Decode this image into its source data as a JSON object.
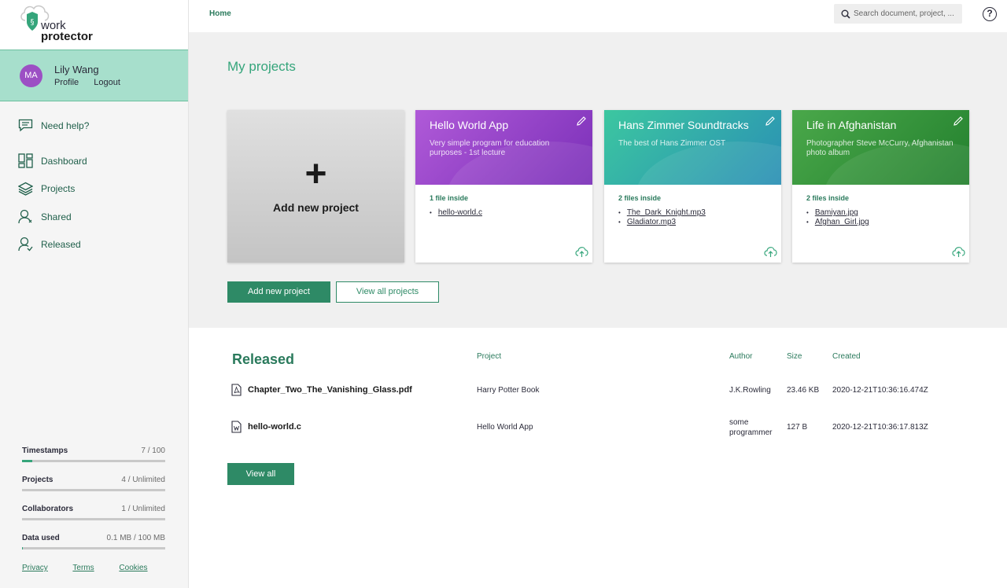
{
  "brand": {
    "line1": "work",
    "line2": "protector"
  },
  "user": {
    "initials": "MA",
    "name": "Lily Wang",
    "profile_label": "Profile",
    "logout_label": "Logout"
  },
  "nav": {
    "help": "Need help?",
    "items": [
      {
        "label": "Dashboard",
        "icon": "dashboard-icon"
      },
      {
        "label": "Projects",
        "icon": "layers-icon"
      },
      {
        "label": "Shared",
        "icon": "shared-user-icon"
      },
      {
        "label": "Released",
        "icon": "released-user-icon"
      }
    ]
  },
  "usage": [
    {
      "label": "Timestamps",
      "value": "7 / 100",
      "fraction": 0.07
    },
    {
      "label": "Projects",
      "value": "4 / Unlimited",
      "fraction": 0
    },
    {
      "label": "Collaborators",
      "value": "1 / Unlimited",
      "fraction": 0
    },
    {
      "label": "Data used",
      "value": "0.1 MB / 100 MB",
      "fraction": 0.001
    }
  ],
  "footer": {
    "privacy": "Privacy",
    "terms": "Terms",
    "cookies": "Cookies"
  },
  "topbar": {
    "home": "Home",
    "search_placeholder": "Search document, project, ..."
  },
  "projects_section": {
    "title": "My projects",
    "add_card_label": "Add new project",
    "add_button": "Add new project",
    "view_all_button": "View all projects",
    "cards": [
      {
        "title": "Hello World App",
        "description": "Very simple program for education purposes - 1st lecture",
        "count": "1 file inside",
        "files": [
          "hello-world.c"
        ],
        "color_from": "#b05ad8",
        "color_to": "#7a2fb8"
      },
      {
        "title": "Hans Zimmer Soundtracks",
        "description": "The best of Hans Zimmer OST",
        "count": "2 files inside",
        "files": [
          "The_Dark_Knight.mp3",
          "Gladiator.mp3"
        ],
        "color_from": "#3cc7a0",
        "color_to": "#2a8fb5"
      },
      {
        "title": "Life in Afghanistan",
        "description": "Photographer Steve McCurry, Afghanistan photo album",
        "count": "2 files inside",
        "files": [
          "Bamiyan.jpg",
          "Afghan_Girl.jpg"
        ],
        "color_from": "#4aa84a",
        "color_to": "#23802e"
      }
    ]
  },
  "released": {
    "title": "Released",
    "headers": {
      "project": "Project",
      "author": "Author",
      "size": "Size",
      "created": "Created"
    },
    "rows": [
      {
        "name": "Chapter_Two_The_Vanishing_Glass.pdf",
        "icon": "pdf-file-icon",
        "project": "Harry Potter Book",
        "author": "J.K.Rowling",
        "size": "23.46 KB",
        "created": "2020-12-21T10:36:16.474Z"
      },
      {
        "name": "hello-world.c",
        "icon": "document-file-icon",
        "project": "Hello World App",
        "author": "some programmer",
        "size": "127 B",
        "created": "2020-12-21T10:36:17.813Z"
      }
    ],
    "view_all": "View all"
  },
  "colors": {
    "accent": "#2e8a66",
    "accent_light": "#35a57b",
    "user_box": "#a7dfcc",
    "avatar": "#9c4fc4"
  }
}
